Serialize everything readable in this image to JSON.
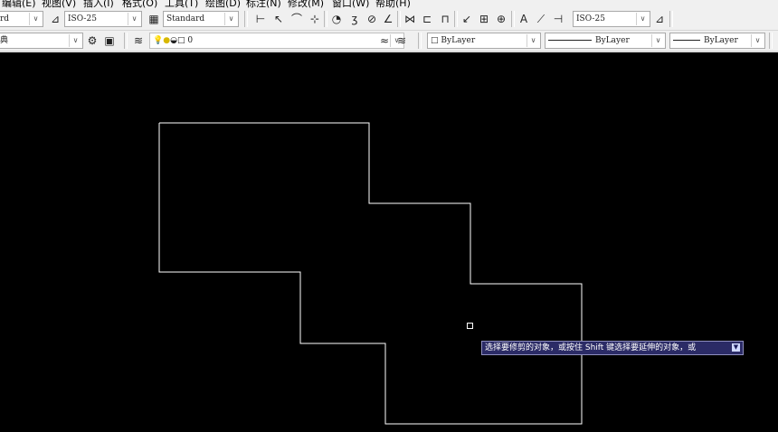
{
  "menu": [
    "编辑(E)",
    "视图(V)",
    "插入(I)",
    "格式(O)",
    "工具(T)",
    "绘图(D)",
    "标注(N)",
    "修改(M)",
    "窗口(W)",
    "帮助(H)"
  ],
  "toolbar1": {
    "text_style": "rd",
    "dim_style": "ISO-25",
    "table_style": "Standard",
    "mleader_style": "ISO-25"
  },
  "toolbar2": {
    "workspace": "典",
    "layer": "0",
    "color": "ByLayer",
    "linetype": "ByLayer",
    "lineweight": "ByLayer"
  },
  "tooltip": {
    "prompt": "选择要修剪的对象，或按住 Shift 键选择要延伸的对象，或",
    "expand_icon": "arrow-down-icon"
  },
  "colors": {
    "canvas_bg": "#000000",
    "drawing_line": "#ffffff",
    "tooltip_bg": "#2b2b66"
  }
}
